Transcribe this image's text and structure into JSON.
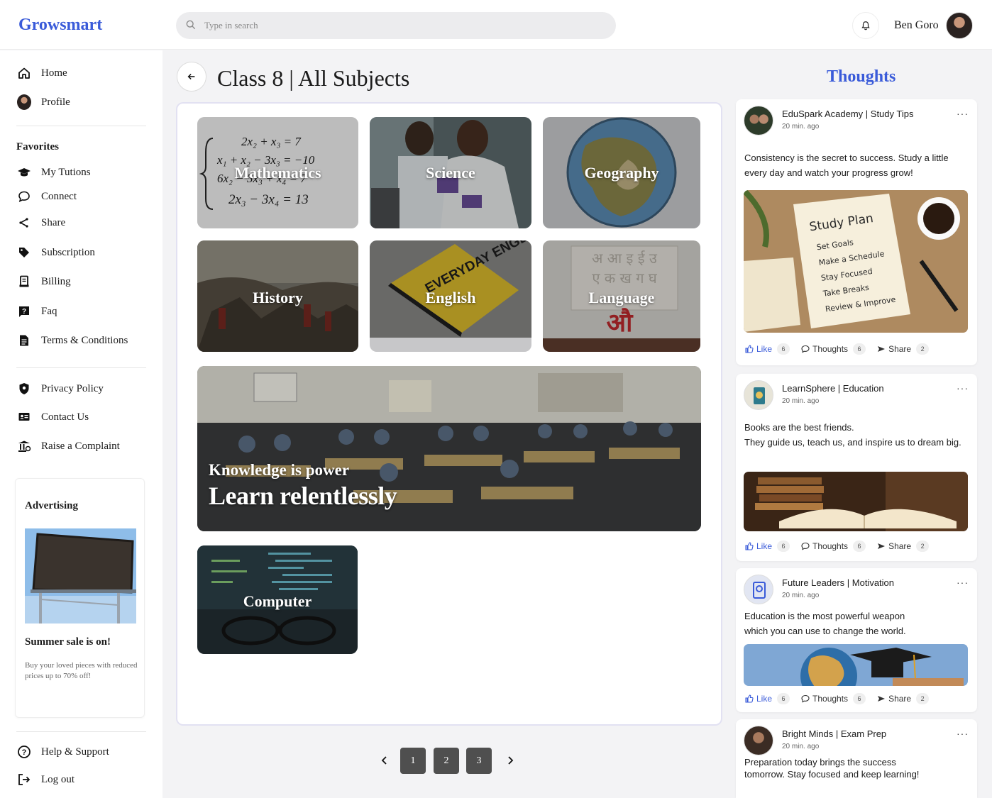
{
  "app": {
    "logo": "Growsmart"
  },
  "search": {
    "placeholder": "Type in search"
  },
  "user": {
    "name": "Ben Goro"
  },
  "sidebar": {
    "main": [
      {
        "label": "Home",
        "icon": "home-icon"
      },
      {
        "label": "Profile",
        "icon": "avatar"
      }
    ],
    "favorites_title": "Favorites",
    "favorites": [
      {
        "label": "My Tutions",
        "icon": "graduation-cap-icon"
      },
      {
        "label": "Connect",
        "icon": "chat-bubble-icon"
      },
      {
        "label": "Share",
        "icon": "share-icon"
      },
      {
        "label": "Subscription",
        "icon": "tag-icon"
      },
      {
        "label": "Billing",
        "icon": "receipt-icon"
      },
      {
        "label": "Faq",
        "icon": "faq-icon"
      },
      {
        "label": "Terms & Conditions",
        "icon": "document-icon"
      }
    ],
    "legal": [
      {
        "label": "Privacy Policy",
        "icon": "shield-icon"
      },
      {
        "label": "Contact Us",
        "icon": "contact-card-icon"
      },
      {
        "label": "Raise a Complaint",
        "icon": "complaint-icon"
      }
    ],
    "advert": {
      "title": "Advertising",
      "headline": "Summer sale is on!",
      "text": "Buy your loved pieces with reduced prices up to 70% off!"
    },
    "bottom": [
      {
        "label": "Help & Support",
        "icon": "help-icon"
      },
      {
        "label": "Log out",
        "icon": "logout-icon"
      }
    ]
  },
  "main": {
    "title": "Class 8 | All Subjects",
    "subjects": [
      {
        "label": "Mathematics"
      },
      {
        "label": "Science"
      },
      {
        "label": "Geography"
      },
      {
        "label": "History"
      },
      {
        "label": "English"
      },
      {
        "label": "Language"
      },
      {
        "label": "Computer"
      }
    ],
    "math_equations": [
      "2x₂ + x₃ = 7",
      "x₁ + x₂ − 3x₃ = −10",
      "6x₂ − 5x₃ + x₄ = 7",
      "2x₃ − 3x₄ = 13"
    ],
    "english_book": "EVERYDAY ENGLISH",
    "language_glyphs": {
      "rows": [
        "अ आ इ ई उ",
        "ए क ख ग घ"
      ],
      "highlight": "औ"
    },
    "banner": {
      "line1": "Knowledge is power",
      "line2": "Learn relentlessly"
    },
    "pagination": {
      "pages": [
        "1",
        "2",
        "3"
      ],
      "prev": "‹",
      "next": "›"
    }
  },
  "thoughts": {
    "title": "Thoughts",
    "posts": [
      {
        "author": "EduSpark Academy | Study Tips",
        "time": "20 min. ago",
        "text": "Consistency is the secret to success. Study a little every day and watch your progress grow!",
        "image_caption": "Study Plan",
        "image_list": [
          "Set Goals",
          "Make a Schedule",
          "Stay Focused",
          "Take Breaks",
          "Review & Improve"
        ],
        "like": "Like",
        "likes": "6",
        "thoughts_label": "Thoughts",
        "thoughts": "6",
        "share": "Share",
        "shares": "2"
      },
      {
        "author": "LearnSphere | Education",
        "time": "20 min. ago",
        "text": "Books are the best friends.\nThey guide us, teach us, and inspire us to dream big.",
        "like": "Like",
        "likes": "6",
        "thoughts_label": "Thoughts",
        "thoughts": "6",
        "share": "Share",
        "shares": "2"
      },
      {
        "author": "Future Leaders | Motivation",
        "time": "20 min. ago",
        "text": "Education is the most powerful weapon which you can use to change the world.",
        "like": "Like",
        "likes": "6",
        "thoughts_label": "Thoughts",
        "thoughts": "6",
        "share": "Share",
        "shares": "2"
      },
      {
        "author": "Bright Minds | Exam Prep",
        "time": "20 min. ago",
        "text": "Preparation today brings the success tomorrow. Stay focused and keep learning!"
      }
    ]
  },
  "colors": {
    "accent": "#3a5bd9",
    "panel_border": "#e2e1f2",
    "page_button": "#4f4f4f"
  }
}
